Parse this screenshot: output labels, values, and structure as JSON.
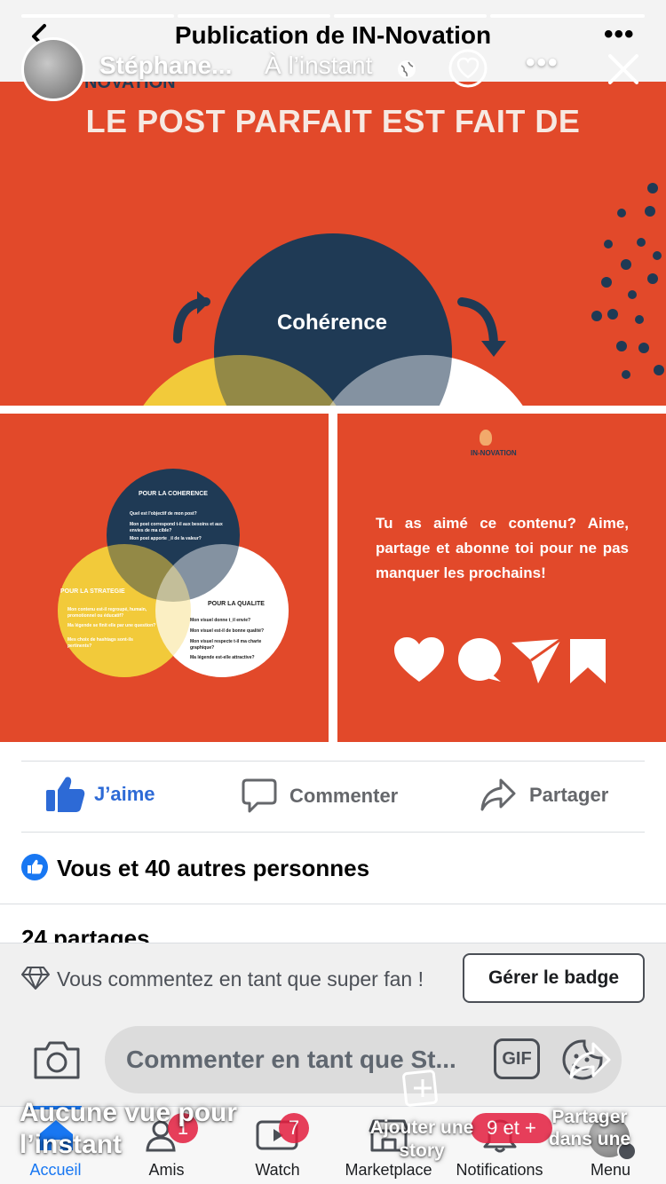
{
  "header": {
    "title": "Publication de IN-Novation",
    "story_author": "Stéphane...",
    "story_time": "À l’instant"
  },
  "post": {
    "image_top": {
      "brand": "NOVATION",
      "headline": "LE POST PARFAIT EST FAIT DE",
      "center_circle_label": "Cohérence"
    },
    "image_left": {
      "section_coherence": "POUR LA COHERENCE",
      "coherence_questions": [
        "Quel est l'objectif de mon post?",
        "Mon post correspond t-il aux besoins et aux envies de ma cible?",
        "Mon post apporte _il de la valeur?"
      ],
      "section_strategie": "POUR LA STRATEGIE",
      "strategie_questions": [
        "Mon contenu est-il regroupé, humain, promotionnel ou éducatif?",
        "Ma légende se finit elle par une question?",
        "Mes choix de hashtags sont-ils pertinents?"
      ],
      "section_qualite": "POUR LA QUALITE",
      "qualite_questions": [
        "Mon visuel donne t_il envie?",
        "Mon visuel est-il de bonne qualité?",
        "Mon visuel respecte t-il ma charte graphique?",
        "Ma légende est-elle attractive?"
      ]
    },
    "image_right": {
      "brand": "IN-NOVATION",
      "cta": "Tu as aimé ce contenu? Aime, partage et abonne toi pour ne pas manquer les prochains!",
      "icons": [
        "heart-icon",
        "speech-bubble-icon",
        "paper-plane-icon",
        "bookmark-icon"
      ]
    }
  },
  "actions": {
    "like": "J’aime",
    "comment": "Commenter",
    "share": "Partager"
  },
  "reactions": {
    "text": "Vous et 40 autres personnes"
  },
  "shares": {
    "text": "24 partages"
  },
  "superfan": {
    "text": "Vous commentez en tant que super fan !",
    "button": "Gérer le badge"
  },
  "comment_bar": {
    "placeholder": "Commenter en tant que St...",
    "gif": "GIF"
  },
  "bottom_nav": {
    "items": [
      {
        "label": "Accueil",
        "icon": "home-icon"
      },
      {
        "label": "Amis",
        "icon": "friends-icon",
        "badge": "1"
      },
      {
        "label": "Watch",
        "icon": "watch-icon",
        "badge": "7"
      },
      {
        "label": "Marketplace",
        "icon": "marketplace-icon"
      },
      {
        "label": "Notifications",
        "icon": "bell-icon",
        "badge": "9 et +"
      },
      {
        "label": "Menu",
        "icon": "menu-avatar-icon"
      }
    ]
  },
  "story_overlay": {
    "views": "Aucune vue pour l’instant",
    "add_story": "Ajouter une story",
    "share_in": "Partager dans une"
  },
  "colors": {
    "post_orange": "#e2492a",
    "navy": "#1f3a55",
    "yellow": "#f2cb3a",
    "facebook_blue": "#1877f2",
    "like_blue": "#2d6ad6",
    "badge_red": "#e41e3f"
  }
}
